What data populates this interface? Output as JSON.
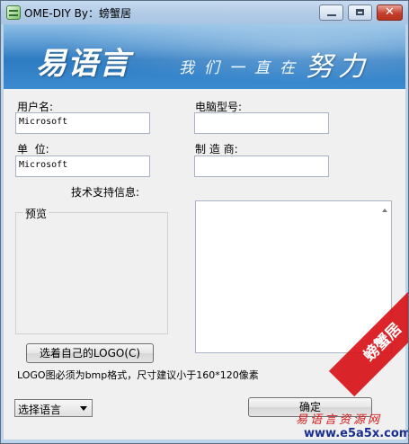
{
  "window": {
    "title": "OME-DIY  By：螃蟹居"
  },
  "banner": {
    "logo_text": "易语言",
    "slogan": "我们一直在",
    "slogan_emphasis": "努力"
  },
  "form": {
    "username_label": "用户名:",
    "username_value": "Microsoft",
    "unit_label": "单  位:",
    "unit_value": "Microsoft",
    "model_label": "电脑型号:",
    "model_value": "",
    "manufacturer_label": "制 造 商:",
    "manufacturer_value": "",
    "support_label": "技术支持信息:",
    "support_value": "",
    "preview_label": "预览",
    "select_logo_button": "选着自己的LOGO(C)",
    "logo_hint": "LOGO图必须为bmp格式，尺寸建议小于160*120像素",
    "language_select": "选择语言",
    "ok_button": "确定"
  },
  "watermark": {
    "ribbon": "螃蟹居",
    "site_name": "易语言资源网",
    "url": "www.e5a5x.com"
  },
  "colors": {
    "title_bar": "#b4cde8",
    "banner_blue": "#2d7bc2",
    "client_bg": "#f0f0f0",
    "watermark_red": "#d8131a"
  }
}
